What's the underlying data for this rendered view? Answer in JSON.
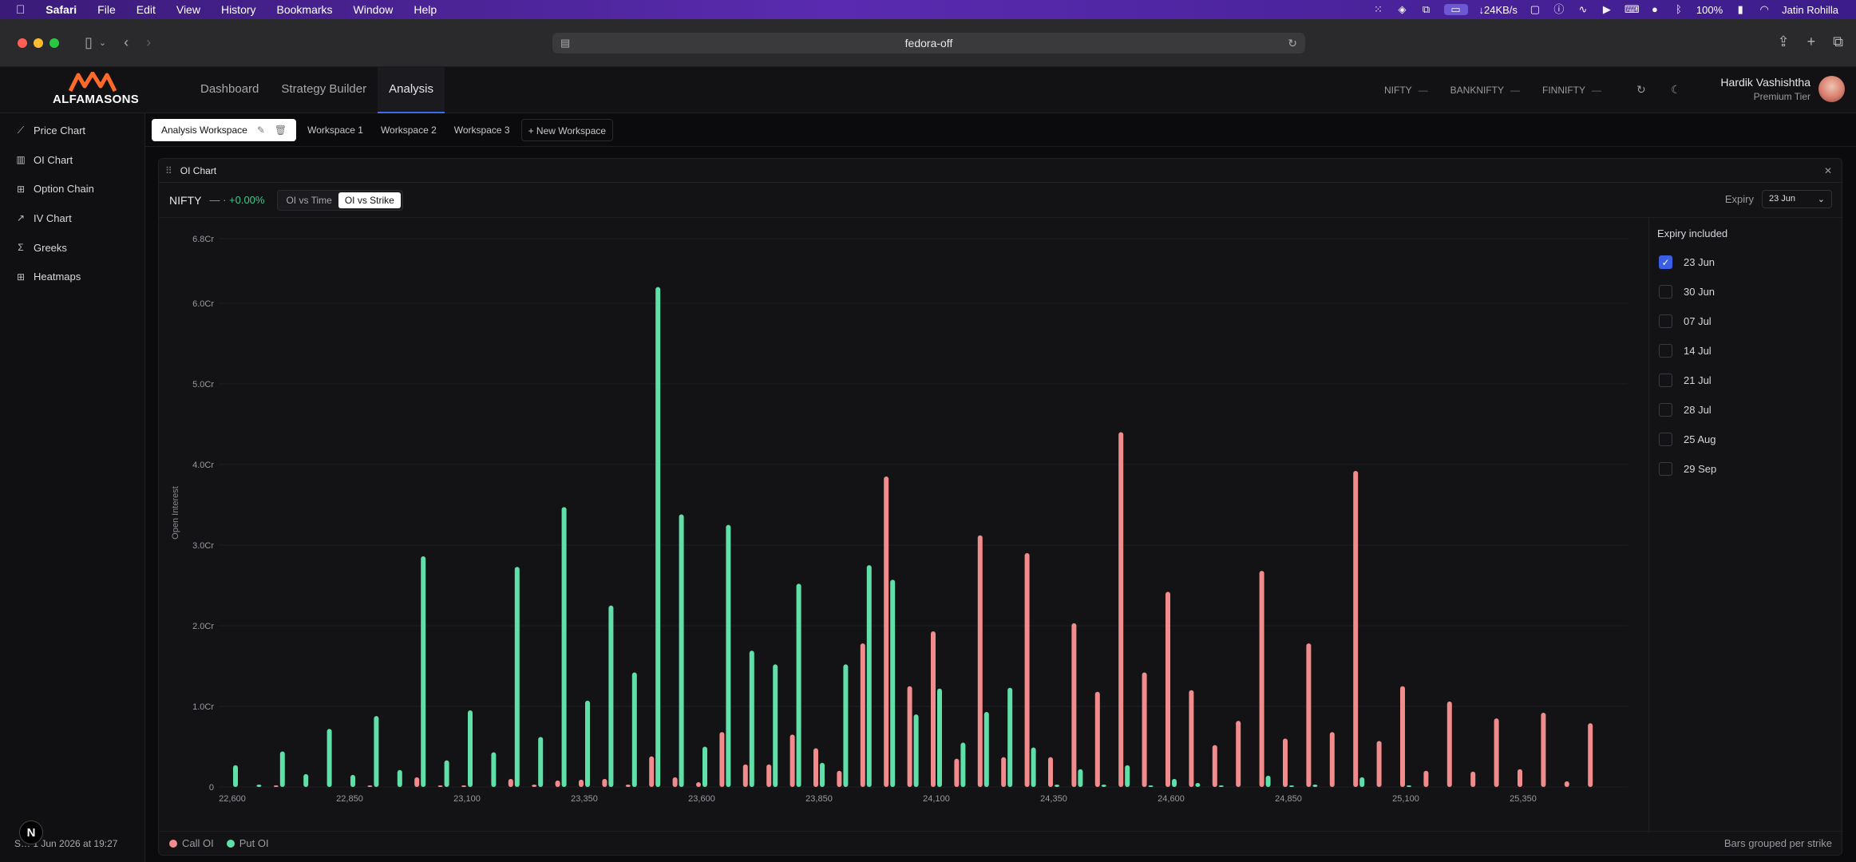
{
  "menubar": {
    "app_name": "Safari",
    "items": [
      "File",
      "Edit",
      "View",
      "History",
      "Bookmarks",
      "Window",
      "Help"
    ],
    "net_speed": "↓24KB/s",
    "battery": "100%",
    "user": "Jatin Rohilla"
  },
  "browser": {
    "url": "fedora-off"
  },
  "app": {
    "logo_text": "ALFAMASONS",
    "nav": [
      "Dashboard",
      "Strategy Builder",
      "Analysis"
    ],
    "active_nav": "Analysis",
    "tickers": [
      {
        "name": "NIFTY",
        "value": "—"
      },
      {
        "name": "BANKNIFTY",
        "value": "—"
      },
      {
        "name": "FINNIFTY",
        "value": "—"
      }
    ],
    "user_name": "Hardik Vashishtha",
    "user_tier": "Premium Tier"
  },
  "sidebar": {
    "items": [
      {
        "label": "Price Chart",
        "icon": "line-chart-icon"
      },
      {
        "label": "OI Chart",
        "icon": "bar-chart-icon"
      },
      {
        "label": "Option Chain",
        "icon": "grid-icon"
      },
      {
        "label": "IV Chart",
        "icon": "trend-icon"
      },
      {
        "label": "Greeks",
        "icon": "sigma-icon"
      },
      {
        "label": "Heatmaps",
        "icon": "grid-icon"
      }
    ],
    "footer": "S… 1 Jun 2026 at 19:27"
  },
  "workspaces": {
    "active": "Analysis Workspace",
    "others": [
      "Workspace 1",
      "Workspace 2",
      "Workspace 3"
    ],
    "new_label": "+ New Workspace"
  },
  "panel": {
    "title": "OI Chart",
    "symbol": "NIFTY",
    "change": "— · +0.00%",
    "modes": [
      "OI vs Time",
      "OI vs Strike"
    ],
    "active_mode": "OI vs Strike",
    "expiry_label": "Expiry",
    "expiry_value": "23 Jun",
    "expiry_title": "Expiry included",
    "expiries": [
      {
        "label": "23 Jun",
        "checked": true
      },
      {
        "label": "30 Jun",
        "checked": false
      },
      {
        "label": "07 Jul",
        "checked": false
      },
      {
        "label": "14 Jul",
        "checked": false
      },
      {
        "label": "21 Jul",
        "checked": false
      },
      {
        "label": "28 Jul",
        "checked": false
      },
      {
        "label": "25 Aug",
        "checked": false
      },
      {
        "label": "29 Sep",
        "checked": false
      }
    ],
    "legend": [
      "Call OI",
      "Put OI"
    ],
    "footnote": "Bars grouped per strike"
  },
  "chart_data": {
    "type": "bar",
    "ylabel": "Open Interest",
    "ylim": [
      0,
      6.8
    ],
    "y_ticks": [
      {
        "value": 0,
        "label": "0"
      },
      {
        "value": 1,
        "label": "1.0Cr"
      },
      {
        "value": 2,
        "label": "2.0Cr"
      },
      {
        "value": 3,
        "label": "3.0Cr"
      },
      {
        "value": 4,
        "label": "4.0Cr"
      },
      {
        "value": 5,
        "label": "5.0Cr"
      },
      {
        "value": 6,
        "label": "6.0Cr"
      },
      {
        "value": 6.8,
        "label": "6.8Cr"
      }
    ],
    "x_tick_labels": [
      "22,600",
      "22,850",
      "23,100",
      "23,350",
      "23,600",
      "23,850",
      "24,100",
      "24,350",
      "24,600",
      "24,850",
      "25,100",
      "25,350"
    ],
    "categories": [
      22600,
      22650,
      22700,
      22750,
      22800,
      22850,
      22900,
      22950,
      23000,
      23050,
      23100,
      23150,
      23200,
      23250,
      23300,
      23350,
      23400,
      23450,
      23500,
      23550,
      23600,
      23650,
      23700,
      23750,
      23800,
      23850,
      23900,
      23950,
      24000,
      24050,
      24100,
      24150,
      24200,
      24250,
      24300,
      24350,
      24400,
      24450,
      24500,
      24550,
      24600,
      24650,
      24700,
      24750,
      24800,
      24850,
      24900,
      24950,
      25000,
      25050,
      25100,
      25150,
      25200,
      25250,
      25300,
      25350,
      25400,
      25450,
      25500
    ],
    "series": [
      {
        "name": "Call OI",
        "color": "#f28b8b",
        "values": [
          0,
          0,
          0.02,
          0,
          0,
          0,
          0.02,
          0,
          0.12,
          0.02,
          0.02,
          0,
          0.1,
          0.03,
          0.08,
          0.09,
          0.1,
          0.03,
          0.38,
          0.12,
          0.06,
          0.68,
          0.28,
          0.28,
          0.65,
          0.48,
          0.2,
          1.78,
          3.85,
          1.25,
          1.93,
          0.35,
          3.12,
          0.37,
          2.9,
          0.37,
          2.03,
          1.18,
          4.4,
          1.42,
          2.42,
          1.2,
          0.52,
          0.82,
          2.68,
          0.6,
          1.78,
          0.68,
          3.92,
          0.57,
          1.25,
          0.2,
          1.06,
          0.19,
          0.85,
          0.22,
          0.92,
          0.07,
          0.79
        ]
      },
      {
        "name": "Put OI",
        "color": "#5ee0a8",
        "values": [
          0.27,
          0.03,
          0.44,
          0.16,
          0.72,
          0.15,
          0.88,
          0.21,
          2.86,
          0.33,
          0.95,
          0.43,
          2.73,
          0.62,
          3.47,
          1.07,
          2.25,
          1.42,
          6.2,
          3.38,
          0.5,
          3.25,
          1.69,
          1.52,
          2.52,
          0.3,
          1.52,
          2.75,
          2.57,
          0.9,
          1.22,
          0.55,
          0.93,
          1.23,
          0.49,
          0.03,
          0.22,
          0.03,
          0.27,
          0.02,
          0.1,
          0.05,
          0.02,
          0,
          0.14,
          0.02,
          0.03,
          0,
          0.12,
          0,
          0.02,
          0,
          0,
          0,
          0,
          0,
          0,
          0,
          0
        ]
      }
    ]
  }
}
